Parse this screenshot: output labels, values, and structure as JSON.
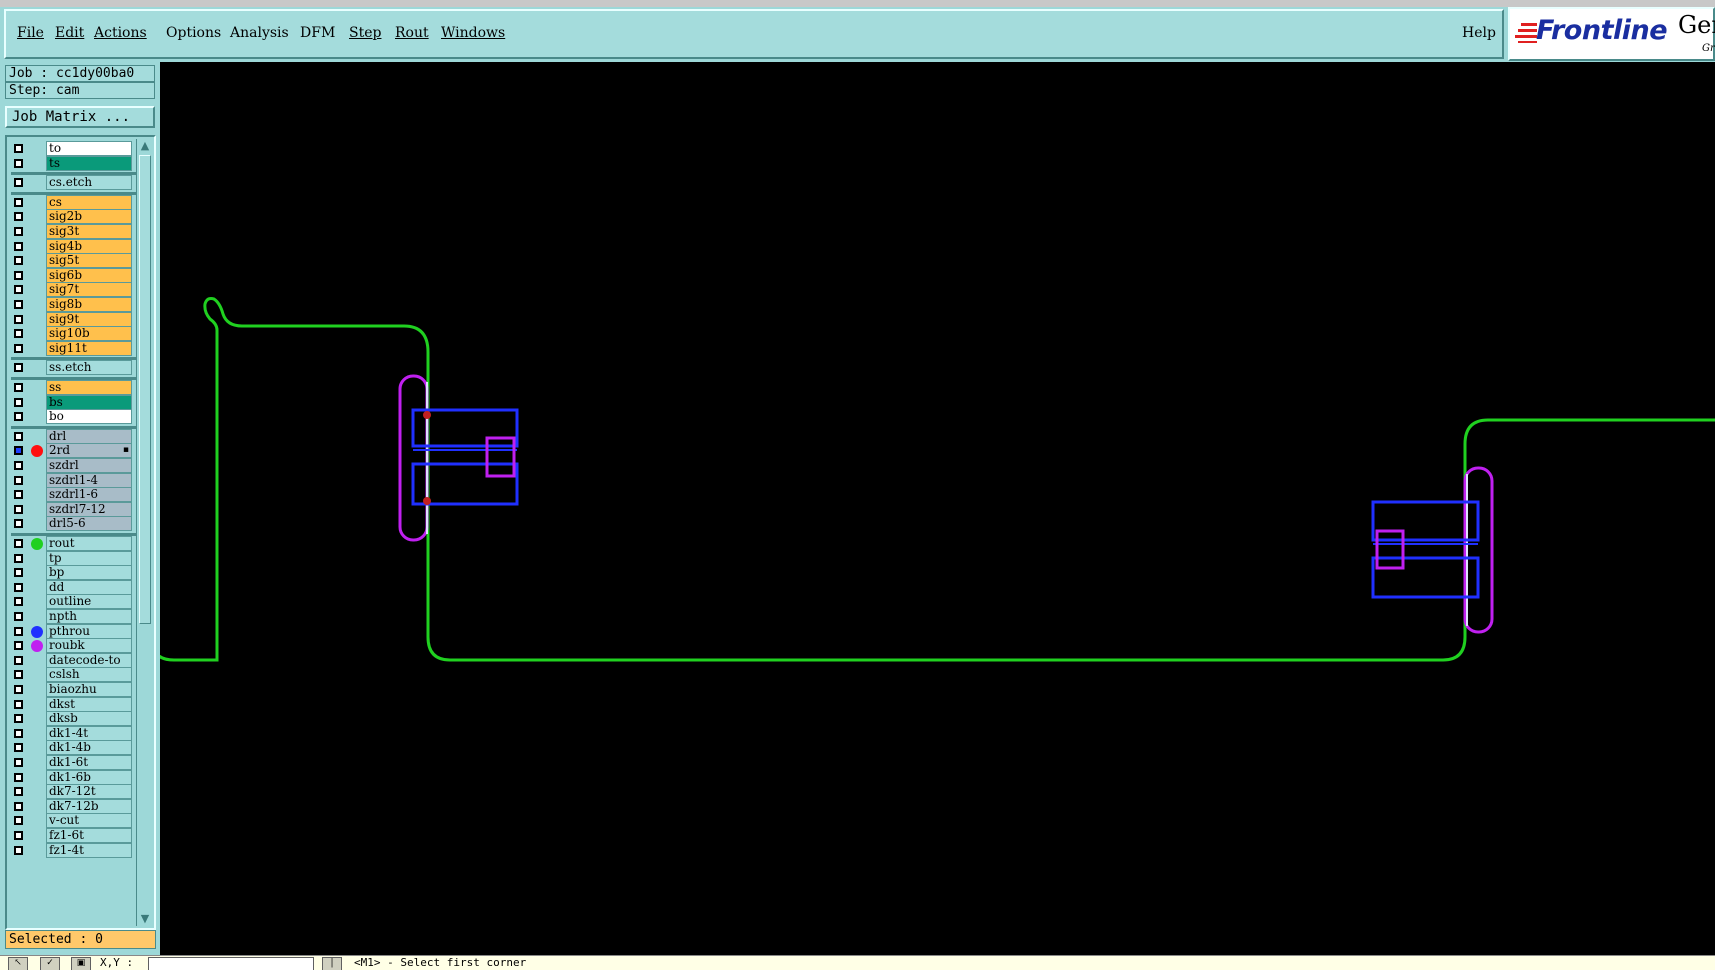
{
  "menu": {
    "file": "File",
    "edit": "Edit",
    "actions": "Actions",
    "options": "Options",
    "analysis": "Analysis",
    "dfm": "DFM",
    "step": "Step",
    "rout": "Rout",
    "windows": "Windows",
    "help": "Help"
  },
  "logo": {
    "brand": "Frontline",
    "app": "Ger",
    "sub": "Gr"
  },
  "job": {
    "job_line": "Job : cc1dy00ba0",
    "step_line": "Step: cam",
    "matrix_button": "Job Matrix ..."
  },
  "layers": [
    {
      "name": "to",
      "color": "#ffffff"
    },
    {
      "name": "ts",
      "color": "#0a9a7a"
    },
    {
      "name": "cs.etch",
      "color": "#a4dcdc"
    },
    {
      "name": "cs",
      "color": "#ffc04c"
    },
    {
      "name": "sig2b",
      "color": "#ffc04c"
    },
    {
      "name": "sig3t",
      "color": "#ffc04c"
    },
    {
      "name": "sig4b",
      "color": "#ffc04c"
    },
    {
      "name": "sig5t",
      "color": "#ffc04c"
    },
    {
      "name": "sig6b",
      "color": "#ffc04c"
    },
    {
      "name": "sig7t",
      "color": "#ffc04c"
    },
    {
      "name": "sig8b",
      "color": "#ffc04c"
    },
    {
      "name": "sig9t",
      "color": "#ffc04c"
    },
    {
      "name": "sig10b",
      "color": "#ffc04c"
    },
    {
      "name": "sig11t",
      "color": "#ffc04c"
    },
    {
      "name": "ss.etch",
      "color": "#a4dcdc"
    },
    {
      "name": "ss",
      "color": "#ffc04c"
    },
    {
      "name": "bs",
      "color": "#0a9a7a"
    },
    {
      "name": "bo",
      "color": "#ffffff"
    },
    {
      "name": "drl",
      "color": "#a8bcc8"
    },
    {
      "name": "2rd",
      "color": "#a8bcc8",
      "dot": "#ff1010",
      "checked": true,
      "flag": "▪"
    },
    {
      "name": "szdrl",
      "color": "#a8bcc8"
    },
    {
      "name": "szdrl1-4",
      "color": "#a8bcc8"
    },
    {
      "name": "szdrl1-6",
      "color": "#a8bcc8"
    },
    {
      "name": "szdrl7-12",
      "color": "#a8bcc8"
    },
    {
      "name": "drl5-6",
      "color": "#a8bcc8"
    },
    {
      "name": "rout",
      "color": "#a4dcdc",
      "dot": "#20d020"
    },
    {
      "name": "tp",
      "color": "#a4dcdc"
    },
    {
      "name": "bp",
      "color": "#a4dcdc"
    },
    {
      "name": "dd",
      "color": "#a4dcdc"
    },
    {
      "name": "outline",
      "color": "#a4dcdc"
    },
    {
      "name": "npth",
      "color": "#a4dcdc"
    },
    {
      "name": "pthrou",
      "color": "#a4dcdc",
      "dot": "#2030ff"
    },
    {
      "name": "roubk",
      "color": "#a4dcdc",
      "dot": "#c020f0"
    },
    {
      "name": "datecode-to",
      "color": "#a4dcdc"
    },
    {
      "name": "cslsh",
      "color": "#a4dcdc"
    },
    {
      "name": "biaozhu",
      "color": "#a4dcdc"
    },
    {
      "name": "dkst",
      "color": "#a4dcdc"
    },
    {
      "name": "dksb",
      "color": "#a4dcdc"
    },
    {
      "name": "dk1-4t",
      "color": "#a4dcdc"
    },
    {
      "name": "dk1-4b",
      "color": "#a4dcdc"
    },
    {
      "name": "dk1-6t",
      "color": "#a4dcdc"
    },
    {
      "name": "dk1-6b",
      "color": "#a4dcdc"
    },
    {
      "name": "dk7-12t",
      "color": "#a4dcdc"
    },
    {
      "name": "dk7-12b",
      "color": "#a4dcdc"
    },
    {
      "name": "v-cut",
      "color": "#a4dcdc"
    },
    {
      "name": "fz1-6t",
      "color": "#a4dcdc"
    },
    {
      "name": "fz1-4t",
      "color": "#a4dcdc"
    }
  ],
  "selected_text": "Selected : 0",
  "status": {
    "xy_label": "X,Y :",
    "xy_value": "",
    "prompt": "<M1> - Select first corner"
  },
  "colors": {
    "panel": "#9dd8d8",
    "outline": "#20d020",
    "pads": "#2030ff",
    "rout": "#c020f0",
    "drill": "#e0e0ff",
    "canvas": "#000000"
  }
}
